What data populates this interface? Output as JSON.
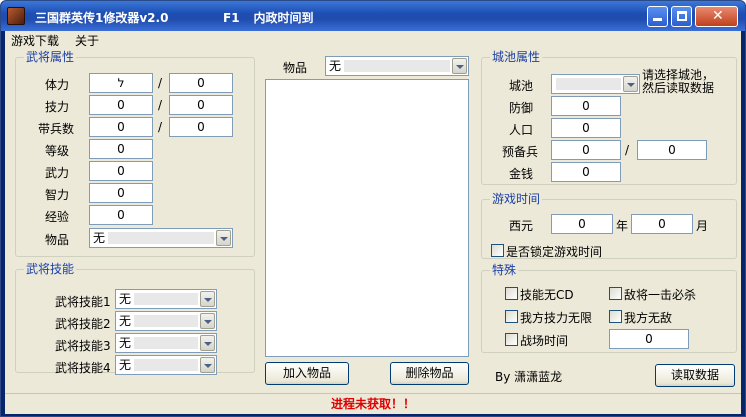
{
  "window": {
    "title": "三国群英传1修改器v2.0",
    "hotkey": "F1",
    "hotkey_desc": "内政时间到"
  },
  "menu": [
    "游戏下载",
    "关于"
  ],
  "general_attrs": {
    "label": "武将属性",
    "hp_label": "体力",
    "hp_value": "ל",
    "hp_max": "0",
    "skill_label": "技力",
    "skill_value": "0",
    "skill_max": "0",
    "troops_label": "带兵数",
    "troops_value": "0",
    "troops_max": "0",
    "level_label": "等级",
    "level_value": "0",
    "force_label": "武力",
    "force_value": "0",
    "intel_label": "智力",
    "intel_value": "0",
    "exp_label": "经验",
    "exp_value": "0",
    "item_label": "物品",
    "item_value": "无",
    "slash": "/"
  },
  "general_skills": {
    "label": "武将技能",
    "skills": [
      {
        "label": "武将技能1",
        "value": "无"
      },
      {
        "label": "武将技能2",
        "value": "无"
      },
      {
        "label": "武将技能3",
        "value": "无"
      },
      {
        "label": "武将技能4",
        "value": "无"
      }
    ]
  },
  "items_panel": {
    "label": "物品",
    "value": "无",
    "add_button": "加入物品",
    "delete_button": "删除物品"
  },
  "city_attrs": {
    "label": "城池属性",
    "city_label": "城池",
    "city_hint_1": "请选择城池，",
    "city_hint_2": "然后读取数据",
    "defense_label": "防御",
    "defense_value": "0",
    "population_label": "人口",
    "population_value": "0",
    "reserve_label": "预备兵",
    "reserve_value": "0",
    "reserve_max": "0",
    "money_label": "金钱",
    "money_value": "0",
    "slash": "/"
  },
  "game_time": {
    "label": "游戏时间",
    "era_label": "西元",
    "year_value": "0",
    "year_unit": "年",
    "month_value": "0",
    "month_unit": "月",
    "lock_label": "是否锁定游戏时间"
  },
  "special": {
    "label": "特殊",
    "no_cd": "技能无CD",
    "one_hit": "敌将一击必杀",
    "infinite_skill": "我方技力无限",
    "invincible": "我方无敌",
    "battle_time": "战场时间",
    "battle_time_value": "0"
  },
  "author": "By 潇潇蓝龙",
  "read_button": "读取数据",
  "status": "进程未获取！！"
}
